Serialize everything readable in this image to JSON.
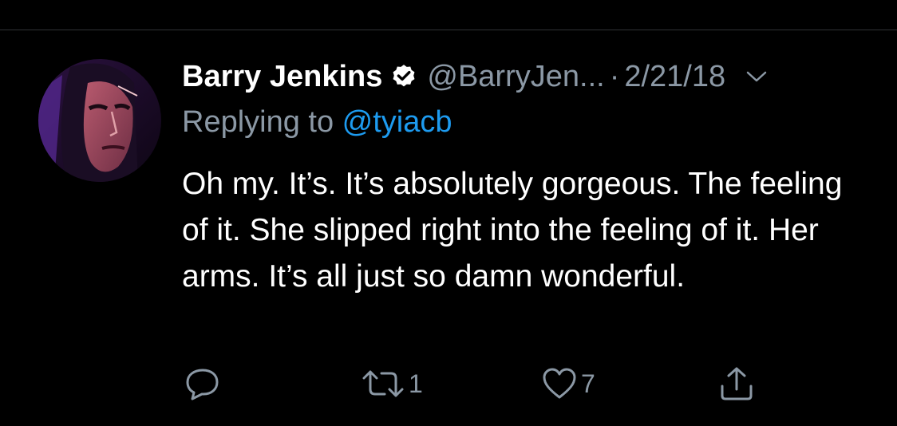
{
  "tweet": {
    "display_name": "Barry Jenkins",
    "handle": "@BarryJen...",
    "separator": "·",
    "date": "2/21/18",
    "replying_prefix": "Replying to ",
    "replying_mention": "@tyiacb",
    "body": "Oh my. It’s. It’s absolutely gorgeous. The feeling of it. She slipped right into the feeling of it. Her arms. It’s all just so damn wonderful.",
    "avatar_icon": "avatar",
    "verified_icon": "verified-badge-icon",
    "more_icon": "chevron-down-icon"
  },
  "actions": {
    "reply": {
      "icon": "reply-icon",
      "count": ""
    },
    "retweet": {
      "icon": "retweet-icon",
      "count": "1"
    },
    "like": {
      "icon": "heart-icon",
      "count": "7"
    },
    "share": {
      "icon": "share-icon",
      "count": ""
    }
  },
  "colors": {
    "background": "#000000",
    "text_primary": "#ffffff",
    "text_secondary": "#8b98a5",
    "link": "#1d9bf0",
    "divider": "#2f3336"
  }
}
